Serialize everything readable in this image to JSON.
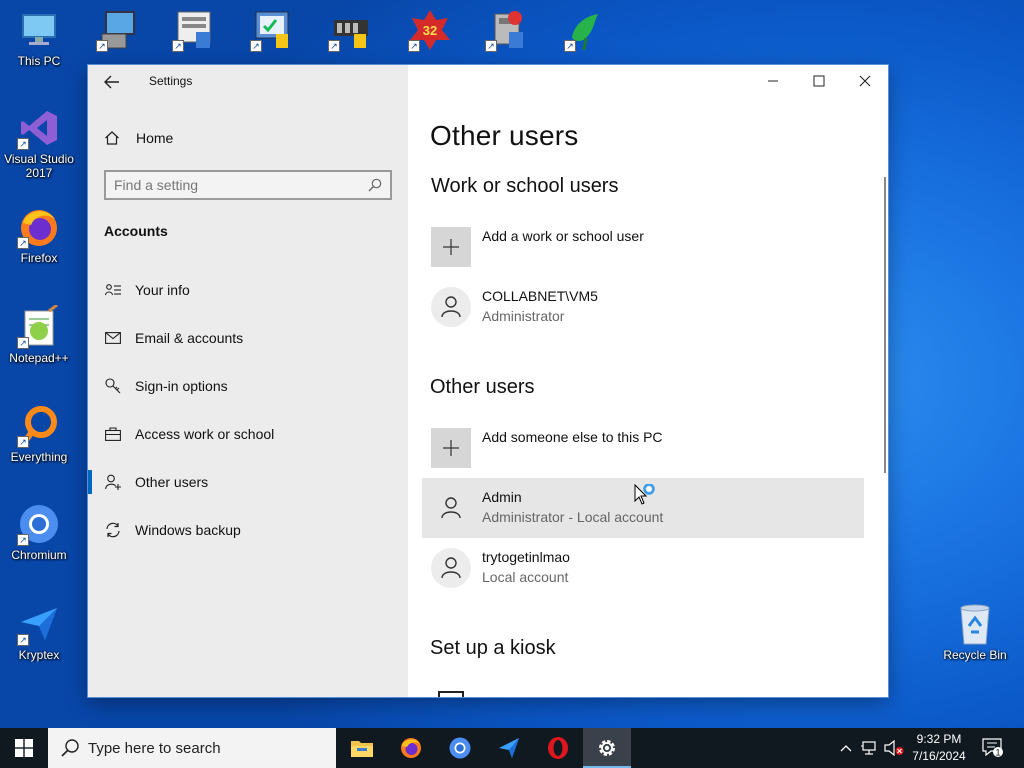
{
  "desktop": {
    "icons_left": [
      {
        "label": "This PC",
        "icon": "this-pc-icon"
      },
      {
        "label": "Visual Studio 2017",
        "icon": "visual-studio-icon"
      },
      {
        "label": "Firefox",
        "icon": "firefox-icon"
      },
      {
        "label": "Notepad++",
        "icon": "notepad-plus-plus-icon"
      },
      {
        "label": "Everything",
        "icon": "everything-search-icon"
      },
      {
        "label": "Chromium",
        "icon": "chromium-icon"
      },
      {
        "label": "Kryptex",
        "icon": "kryptex-icon"
      }
    ],
    "icons_top": [
      {
        "icon": "computer-management-icon"
      },
      {
        "icon": "odbc-data-sources-icon"
      },
      {
        "icon": "system-config-icon"
      },
      {
        "icon": "windows-memory-icon"
      },
      {
        "icon": "info-viewer-32-icon",
        "badge": "32"
      },
      {
        "icon": "recovery-drive-icon"
      },
      {
        "icon": "bird-app-icon"
      }
    ],
    "recycle_bin": {
      "label": "Recycle Bin",
      "icon": "recycle-bin-icon"
    }
  },
  "settings": {
    "title": "Settings",
    "home": "Home",
    "search_placeholder": "Find a setting",
    "section": "Accounts",
    "nav": [
      {
        "label": "Your info",
        "icon": "person-card-icon"
      },
      {
        "label": "Email & accounts",
        "icon": "mail-icon"
      },
      {
        "label": "Sign-in options",
        "icon": "key-icon"
      },
      {
        "label": "Access work or school",
        "icon": "briefcase-icon"
      },
      {
        "label": "Other users",
        "icon": "add-person-icon",
        "selected": true
      },
      {
        "label": "Windows backup",
        "icon": "sync-icon"
      }
    ],
    "content": {
      "title": "Other users",
      "work_heading": "Work or school users",
      "add_work": "Add a work or school user",
      "work_users": [
        {
          "name": "COLLABNET\\VM5",
          "role": "Administrator"
        }
      ],
      "other_heading": "Other users",
      "add_other": "Add someone else to this PC",
      "other_users": [
        {
          "name": "Admin",
          "role": "Administrator - Local account"
        },
        {
          "name": "trytogetinlmao",
          "role": "Local account"
        }
      ],
      "kiosk_heading": "Set up a kiosk"
    }
  },
  "taskbar": {
    "search_placeholder": "Type here to search",
    "apps": [
      {
        "icon": "file-explorer-icon"
      },
      {
        "icon": "firefox-icon"
      },
      {
        "icon": "chromium-icon"
      },
      {
        "icon": "kryptex-icon"
      },
      {
        "icon": "opera-icon"
      },
      {
        "icon": "settings-gear-icon",
        "active": true
      }
    ],
    "time": "9:32 PM",
    "date": "7/16/2024",
    "notification_count": "1"
  }
}
